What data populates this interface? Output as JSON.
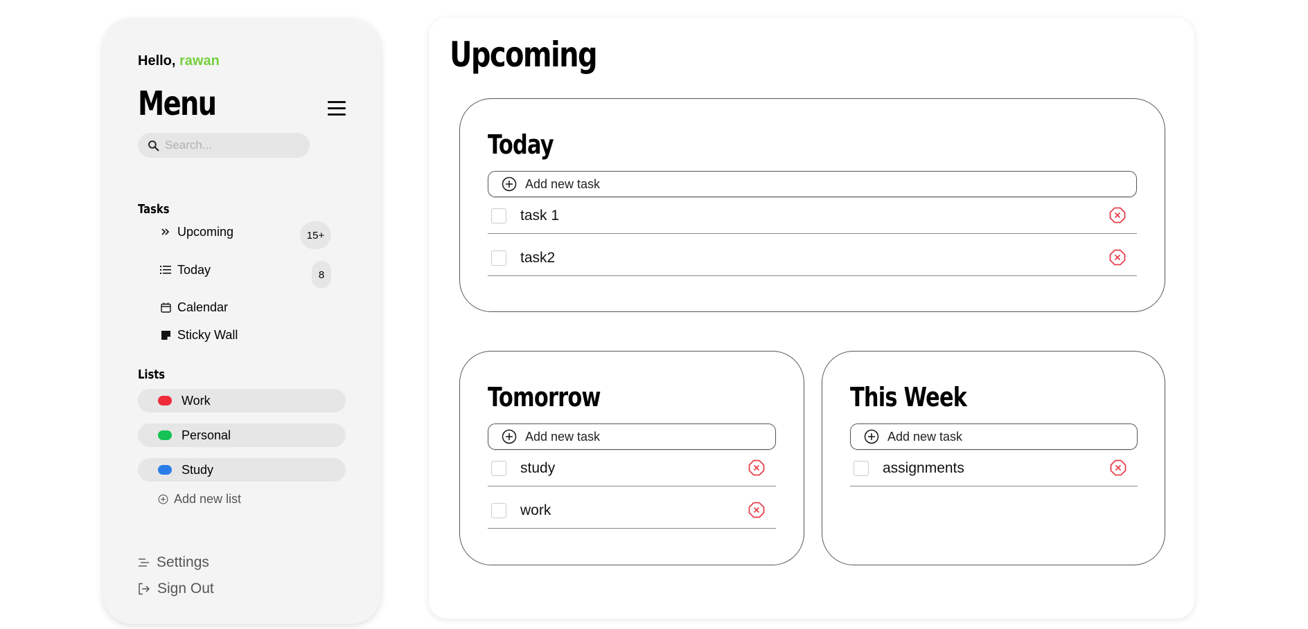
{
  "sidebar": {
    "greeting": "Hello,",
    "username": "rawan",
    "title": "Menu",
    "search_placeholder": "Search...",
    "tasks_heading": "Tasks",
    "tasks": [
      {
        "label": "Upcoming",
        "icon": "double-chevron-right-icon",
        "badge": "15+"
      },
      {
        "label": "Today",
        "icon": "list-icon",
        "badge": "8"
      },
      {
        "label": "Calendar",
        "icon": "calendar-icon"
      },
      {
        "label": "Sticky Wall",
        "icon": "sticky-note-icon"
      }
    ],
    "lists_heading": "Lists",
    "lists": [
      {
        "label": "Work",
        "color": "#ee2b39"
      },
      {
        "label": "Personal",
        "color": "#16c254"
      },
      {
        "label": "Study",
        "color": "#2a7de9"
      }
    ],
    "add_list_label": "Add new list",
    "settings_label": "Settings",
    "signout_label": "Sign Out"
  },
  "main": {
    "title": "Upcoming",
    "add_task_label": "Add new task",
    "sections": {
      "today": {
        "title": "Today",
        "tasks": [
          "task 1",
          "task2"
        ]
      },
      "tomorrow": {
        "title": "Tomorrow",
        "tasks": [
          "study",
          "work"
        ]
      },
      "this_week": {
        "title": "This Week",
        "tasks": [
          "assignments"
        ]
      }
    }
  },
  "colors": {
    "accent_green": "#75d03f",
    "delete_red": "#e8404b",
    "sidebar_bg": "#f4f4f4"
  }
}
